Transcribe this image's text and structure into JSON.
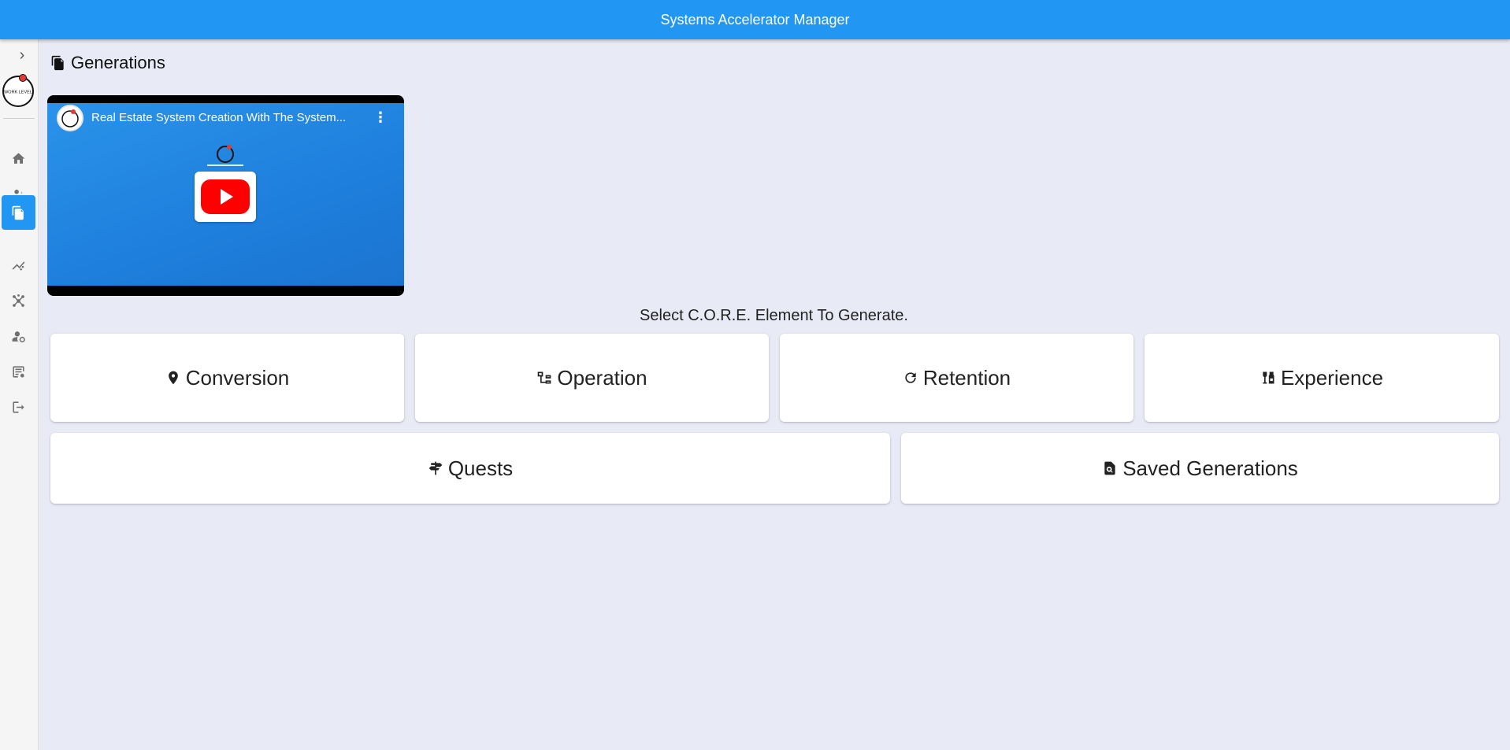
{
  "app": {
    "title": "Systems Accelerator Manager"
  },
  "sidebar": {
    "toggle_icon": "chevron-right-icon",
    "logo_text": "WORK LEVEL",
    "items": [
      {
        "icon": "home-icon",
        "active": false
      },
      {
        "icon": "people-icon",
        "active": false
      },
      {
        "icon": "documents-icon",
        "active": true
      },
      {
        "icon": "analytics-icon",
        "active": false
      },
      {
        "icon": "hub-icon",
        "active": false
      },
      {
        "icon": "user-settings-icon",
        "active": false
      },
      {
        "icon": "report-icon",
        "active": false
      },
      {
        "icon": "logout-icon",
        "active": false
      }
    ],
    "active_color": "#2196f3"
  },
  "page": {
    "title": "Generations",
    "title_icon": "documents-icon"
  },
  "video": {
    "title": "Real Estate System Creation With The System...",
    "menu_icon": "more-vert-icon",
    "play_icon": "youtube-play-icon"
  },
  "prompt": "Select C.O.R.E. Element To Generate.",
  "core_buttons": [
    {
      "label": "Conversion",
      "icon": "location-pin-icon"
    },
    {
      "label": "Operation",
      "icon": "flowchart-icon"
    },
    {
      "label": "Retention",
      "icon": "refresh-icon"
    },
    {
      "label": "Experience",
      "icon": "wine-bar-icon"
    }
  ],
  "secondary_buttons": [
    {
      "label": "Quests",
      "icon": "signpost-icon"
    },
    {
      "label": "Saved Generations",
      "icon": "find-document-icon"
    }
  ],
  "colors": {
    "app_bar": "#2196f3",
    "background": "#e8eaf6",
    "card": "#ffffff"
  }
}
